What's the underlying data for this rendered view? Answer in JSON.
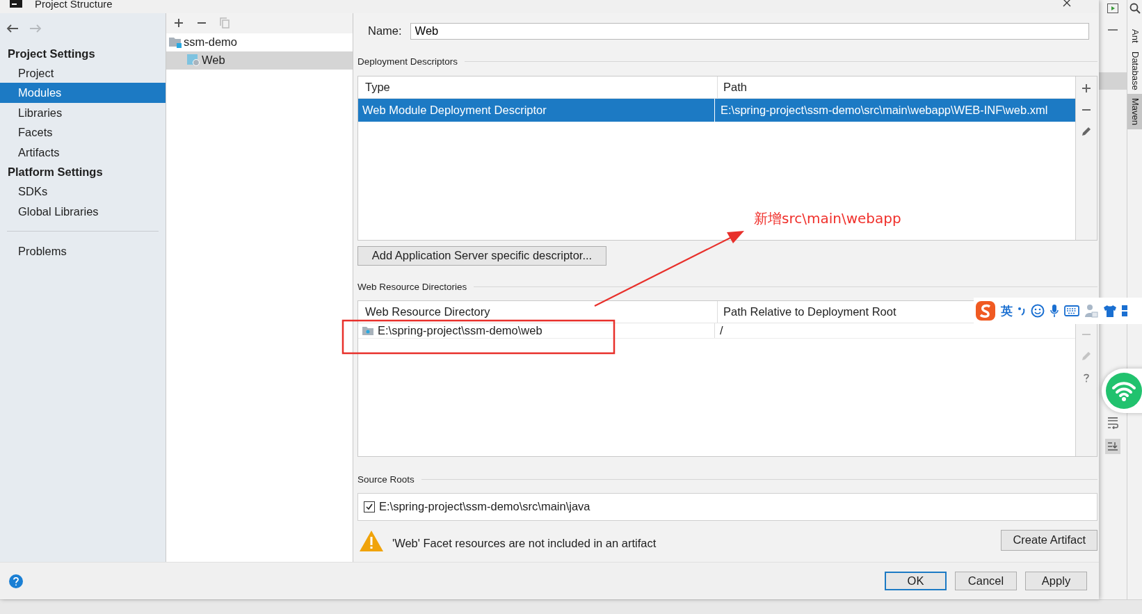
{
  "window": {
    "title": "Project Structure"
  },
  "nav": [
    {
      "kind": "back",
      "disabled": false
    },
    {
      "kind": "forward",
      "disabled": true
    }
  ],
  "sidebar": {
    "sections": [
      {
        "heading": "Project Settings",
        "items": [
          {
            "label": "Project",
            "selected": false
          },
          {
            "label": "Modules",
            "selected": true
          },
          {
            "label": "Libraries",
            "selected": false
          },
          {
            "label": "Facets",
            "selected": false
          },
          {
            "label": "Artifacts",
            "selected": false
          }
        ]
      },
      {
        "heading": "Platform Settings",
        "items": [
          {
            "label": "SDKs",
            "selected": false
          },
          {
            "label": "Global Libraries",
            "selected": false
          }
        ]
      }
    ],
    "footer_items": [
      {
        "label": "Problems",
        "selected": false
      }
    ]
  },
  "tree": {
    "toolbar": [
      {
        "kind": "add",
        "disabled": false
      },
      {
        "kind": "remove",
        "disabled": false
      },
      {
        "kind": "copy",
        "disabled": true
      }
    ],
    "nodes": [
      {
        "label": "ssm-demo",
        "kind": "module",
        "selected": false,
        "children": [
          {
            "label": "Web",
            "kind": "web",
            "selected": true
          }
        ]
      }
    ]
  },
  "facet": {
    "name_label": "Name:",
    "name_value": "Web",
    "deployment": {
      "title": "Deployment Descriptors",
      "columns": [
        "Type",
        "Path"
      ],
      "rows": [
        {
          "cells": [
            "Web Module Deployment Descriptor",
            "E:\\spring-project\\ssm-demo\\src\\main\\webapp\\WEB-INF\\web.xml"
          ],
          "selected": true
        }
      ],
      "tools": [
        {
          "kind": "add",
          "disabled": false
        },
        {
          "kind": "remove",
          "disabled": false
        },
        {
          "kind": "edit",
          "disabled": false
        }
      ]
    },
    "add_server_button": "Add Application Server specific descriptor...",
    "web_resources": {
      "title": "Web Resource Directories",
      "columns": [
        "Web Resource Directory",
        "Path Relative to Deployment Root"
      ],
      "rows": [
        {
          "cells": [
            "E:\\spring-project\\ssm-demo\\web",
            "/"
          ],
          "selected": false
        }
      ],
      "tools": [
        {
          "kind": "remove",
          "disabled": true
        },
        {
          "kind": "edit",
          "disabled": true
        },
        {
          "kind": "help",
          "disabled": false
        }
      ]
    },
    "source_roots": {
      "title": "Source Roots",
      "items": [
        {
          "label": "E:\\spring-project\\ssm-demo\\src\\main\\java",
          "checked": true
        }
      ]
    },
    "warning": "'Web' Facet resources are not included in an artifact",
    "create_artifact_button": "Create Artifact"
  },
  "buttons": [
    {
      "label": "OK",
      "kind": "default"
    },
    {
      "label": "Cancel",
      "kind": "normal"
    },
    {
      "label": "Apply",
      "kind": "normal"
    }
  ],
  "ide_tool_windows": [
    {
      "label": "Ant",
      "selected": false
    },
    {
      "label": "Database",
      "selected": false
    },
    {
      "label": "Maven",
      "selected": true
    }
  ],
  "annotation": {
    "text": "新增src\\main\\webapp"
  },
  "ime_toolbar": {
    "mode": "英"
  }
}
